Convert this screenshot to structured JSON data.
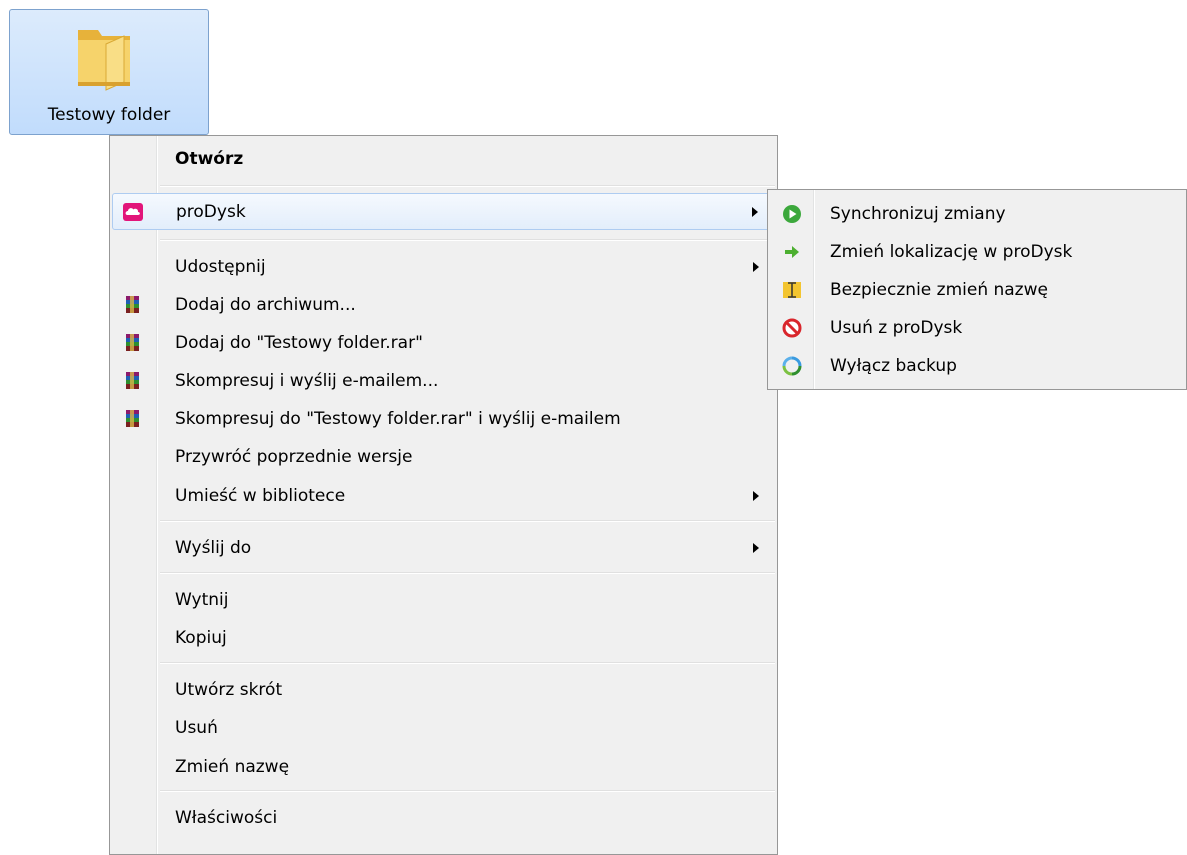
{
  "desktop": {
    "folder": {
      "name": "Testowy folder",
      "icon": "folder-icon"
    }
  },
  "context_menu": {
    "items": [
      {
        "label": "Otwórz",
        "bold": true
      },
      {
        "label": "proDysk",
        "icon": "prodysk-cloud-icon",
        "submenu": true,
        "highlighted": true
      },
      {
        "label": "Udostępnij",
        "submenu": true
      },
      {
        "label": "Dodaj do archiwum...",
        "icon": "winrar-icon"
      },
      {
        "label": "Dodaj do \"Testowy folder.rar\"",
        "icon": "winrar-icon"
      },
      {
        "label": "Skompresuj i wyślij e-mailem...",
        "icon": "winrar-icon"
      },
      {
        "label": "Skompresuj do \"Testowy folder.rar\" i wyślij e-mailem",
        "icon": "winrar-icon"
      },
      {
        "label": "Przywróć poprzednie wersje"
      },
      {
        "label": "Umieść w bibliotece",
        "submenu": true
      },
      {
        "label": "Wyślij do",
        "submenu": true
      },
      {
        "label": "Wytnij"
      },
      {
        "label": "Kopiuj"
      },
      {
        "label": "Utwórz skrót"
      },
      {
        "label": "Usuń"
      },
      {
        "label": "Zmień nazwę"
      },
      {
        "label": "Właściwości"
      }
    ]
  },
  "prodysk_submenu": {
    "items": [
      {
        "label": "Synchronizuj zmiany",
        "icon": "sync-play-icon"
      },
      {
        "label": "Zmień lokalizację w proDysk",
        "icon": "move-arrow-icon"
      },
      {
        "label": "Bezpiecznie zmień nazwę",
        "icon": "rename-cursor-icon"
      },
      {
        "label": "Usuń z proDysk",
        "icon": "remove-circle-icon"
      },
      {
        "label": "Wyłącz backup",
        "icon": "backup-refresh-icon"
      }
    ]
  },
  "colors": {
    "highlight_border": "#aeccf1",
    "menu_bg": "#f0f0f0",
    "prodysk_pink": "#e2157a",
    "folder_yellow": "#f3c94f"
  }
}
